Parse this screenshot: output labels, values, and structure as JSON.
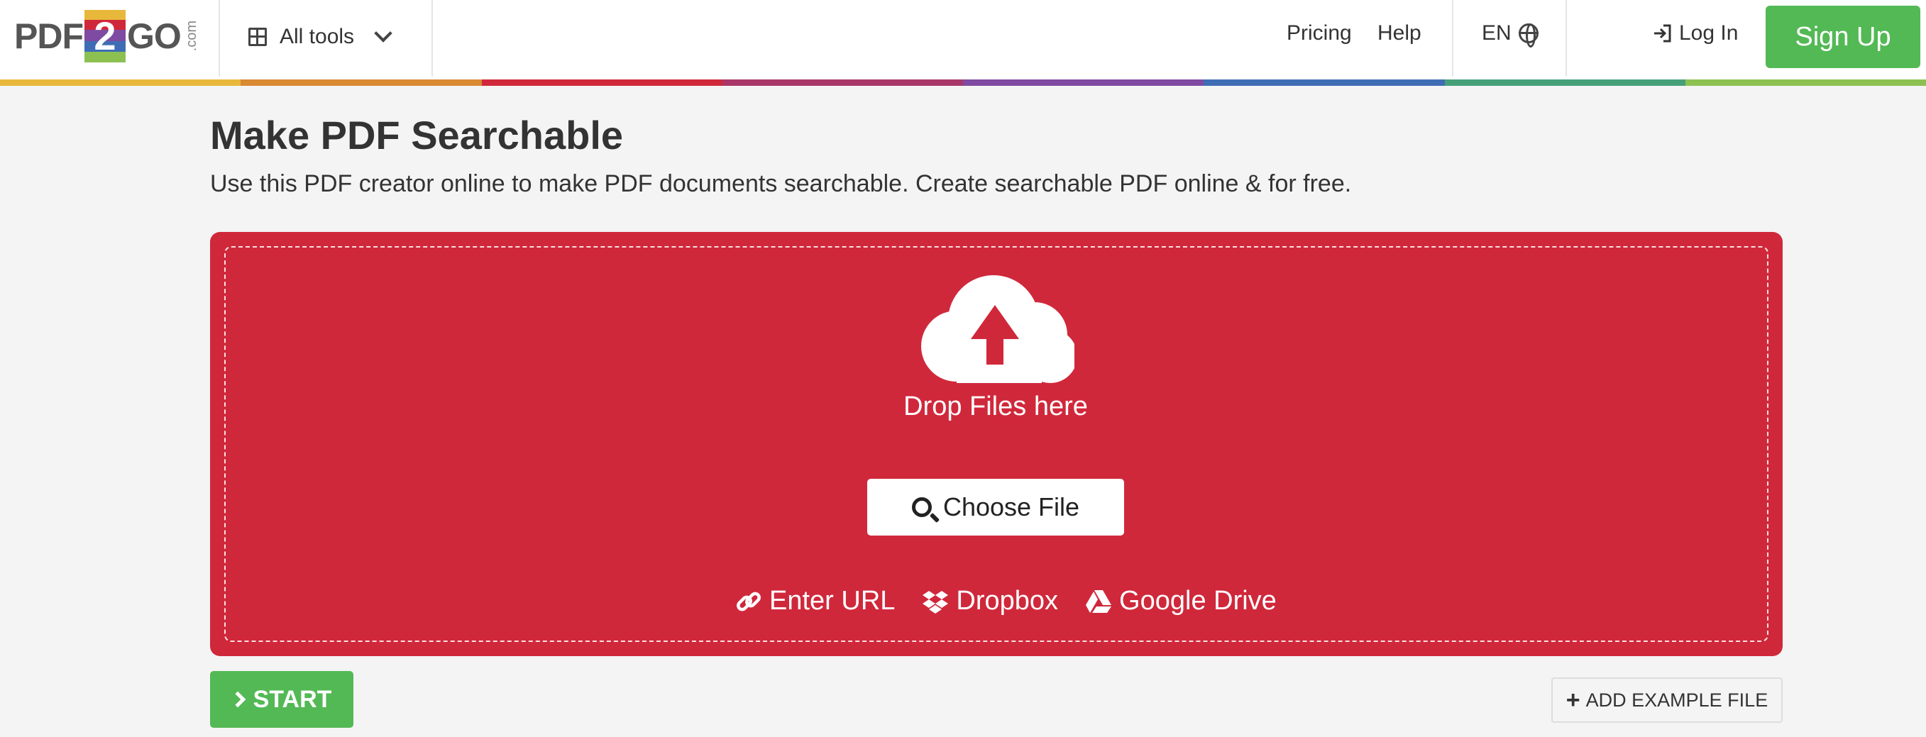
{
  "header": {
    "logo": {
      "left": "PDF",
      "mid": "2",
      "right": "GO",
      "suffix": ".com"
    },
    "all_tools": "All tools",
    "nav": {
      "pricing": "Pricing",
      "help": "Help",
      "lang": "EN"
    },
    "login": "Log In",
    "signup": "Sign Up"
  },
  "rainbow_colors": [
    "#e8b83b",
    "#d98a33",
    "#d0283b",
    "#a93668",
    "#7f4aa1",
    "#3f6db5",
    "#45a07a",
    "#8cc152"
  ],
  "main": {
    "title": "Make PDF Searchable",
    "subtitle": "Use this PDF creator online to make PDF documents searchable. Create searchable PDF online & for free.",
    "drop_text": "Drop Files here",
    "choose_file": "Choose File",
    "sources": {
      "url": "Enter URL",
      "dropbox": "Dropbox",
      "gdrive": "Google Drive"
    },
    "start": "START",
    "add_example": "ADD EXAMPLE FILE"
  },
  "colors": {
    "accent_red": "#d0283b",
    "green": "#53b955"
  },
  "icons": [
    "grid-icon",
    "chevron-down-icon",
    "globe-icon",
    "login-icon",
    "cloud-upload-icon",
    "search-icon",
    "link-icon",
    "dropbox-icon",
    "google-drive-icon",
    "chevron-right-icon",
    "plus-icon"
  ]
}
